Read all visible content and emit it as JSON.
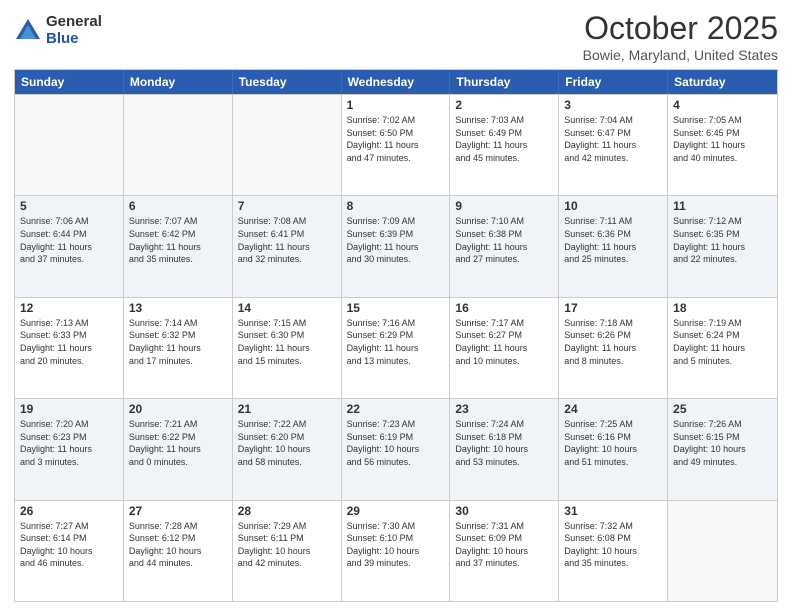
{
  "logo": {
    "general": "General",
    "blue": "Blue"
  },
  "title": "October 2025",
  "location": "Bowie, Maryland, United States",
  "header_days": [
    "Sunday",
    "Monday",
    "Tuesday",
    "Wednesday",
    "Thursday",
    "Friday",
    "Saturday"
  ],
  "rows": [
    {
      "alt": false,
      "cells": [
        {
          "day": "",
          "lines": []
        },
        {
          "day": "",
          "lines": []
        },
        {
          "day": "",
          "lines": []
        },
        {
          "day": "1",
          "lines": [
            "Sunrise: 7:02 AM",
            "Sunset: 6:50 PM",
            "Daylight: 11 hours",
            "and 47 minutes."
          ]
        },
        {
          "day": "2",
          "lines": [
            "Sunrise: 7:03 AM",
            "Sunset: 6:49 PM",
            "Daylight: 11 hours",
            "and 45 minutes."
          ]
        },
        {
          "day": "3",
          "lines": [
            "Sunrise: 7:04 AM",
            "Sunset: 6:47 PM",
            "Daylight: 11 hours",
            "and 42 minutes."
          ]
        },
        {
          "day": "4",
          "lines": [
            "Sunrise: 7:05 AM",
            "Sunset: 6:45 PM",
            "Daylight: 11 hours",
            "and 40 minutes."
          ]
        }
      ]
    },
    {
      "alt": true,
      "cells": [
        {
          "day": "5",
          "lines": [
            "Sunrise: 7:06 AM",
            "Sunset: 6:44 PM",
            "Daylight: 11 hours",
            "and 37 minutes."
          ]
        },
        {
          "day": "6",
          "lines": [
            "Sunrise: 7:07 AM",
            "Sunset: 6:42 PM",
            "Daylight: 11 hours",
            "and 35 minutes."
          ]
        },
        {
          "day": "7",
          "lines": [
            "Sunrise: 7:08 AM",
            "Sunset: 6:41 PM",
            "Daylight: 11 hours",
            "and 32 minutes."
          ]
        },
        {
          "day": "8",
          "lines": [
            "Sunrise: 7:09 AM",
            "Sunset: 6:39 PM",
            "Daylight: 11 hours",
            "and 30 minutes."
          ]
        },
        {
          "day": "9",
          "lines": [
            "Sunrise: 7:10 AM",
            "Sunset: 6:38 PM",
            "Daylight: 11 hours",
            "and 27 minutes."
          ]
        },
        {
          "day": "10",
          "lines": [
            "Sunrise: 7:11 AM",
            "Sunset: 6:36 PM",
            "Daylight: 11 hours",
            "and 25 minutes."
          ]
        },
        {
          "day": "11",
          "lines": [
            "Sunrise: 7:12 AM",
            "Sunset: 6:35 PM",
            "Daylight: 11 hours",
            "and 22 minutes."
          ]
        }
      ]
    },
    {
      "alt": false,
      "cells": [
        {
          "day": "12",
          "lines": [
            "Sunrise: 7:13 AM",
            "Sunset: 6:33 PM",
            "Daylight: 11 hours",
            "and 20 minutes."
          ]
        },
        {
          "day": "13",
          "lines": [
            "Sunrise: 7:14 AM",
            "Sunset: 6:32 PM",
            "Daylight: 11 hours",
            "and 17 minutes."
          ]
        },
        {
          "day": "14",
          "lines": [
            "Sunrise: 7:15 AM",
            "Sunset: 6:30 PM",
            "Daylight: 11 hours",
            "and 15 minutes."
          ]
        },
        {
          "day": "15",
          "lines": [
            "Sunrise: 7:16 AM",
            "Sunset: 6:29 PM",
            "Daylight: 11 hours",
            "and 13 minutes."
          ]
        },
        {
          "day": "16",
          "lines": [
            "Sunrise: 7:17 AM",
            "Sunset: 6:27 PM",
            "Daylight: 11 hours",
            "and 10 minutes."
          ]
        },
        {
          "day": "17",
          "lines": [
            "Sunrise: 7:18 AM",
            "Sunset: 6:26 PM",
            "Daylight: 11 hours",
            "and 8 minutes."
          ]
        },
        {
          "day": "18",
          "lines": [
            "Sunrise: 7:19 AM",
            "Sunset: 6:24 PM",
            "Daylight: 11 hours",
            "and 5 minutes."
          ]
        }
      ]
    },
    {
      "alt": true,
      "cells": [
        {
          "day": "19",
          "lines": [
            "Sunrise: 7:20 AM",
            "Sunset: 6:23 PM",
            "Daylight: 11 hours",
            "and 3 minutes."
          ]
        },
        {
          "day": "20",
          "lines": [
            "Sunrise: 7:21 AM",
            "Sunset: 6:22 PM",
            "Daylight: 11 hours",
            "and 0 minutes."
          ]
        },
        {
          "day": "21",
          "lines": [
            "Sunrise: 7:22 AM",
            "Sunset: 6:20 PM",
            "Daylight: 10 hours",
            "and 58 minutes."
          ]
        },
        {
          "day": "22",
          "lines": [
            "Sunrise: 7:23 AM",
            "Sunset: 6:19 PM",
            "Daylight: 10 hours",
            "and 56 minutes."
          ]
        },
        {
          "day": "23",
          "lines": [
            "Sunrise: 7:24 AM",
            "Sunset: 6:18 PM",
            "Daylight: 10 hours",
            "and 53 minutes."
          ]
        },
        {
          "day": "24",
          "lines": [
            "Sunrise: 7:25 AM",
            "Sunset: 6:16 PM",
            "Daylight: 10 hours",
            "and 51 minutes."
          ]
        },
        {
          "day": "25",
          "lines": [
            "Sunrise: 7:26 AM",
            "Sunset: 6:15 PM",
            "Daylight: 10 hours",
            "and 49 minutes."
          ]
        }
      ]
    },
    {
      "alt": false,
      "cells": [
        {
          "day": "26",
          "lines": [
            "Sunrise: 7:27 AM",
            "Sunset: 6:14 PM",
            "Daylight: 10 hours",
            "and 46 minutes."
          ]
        },
        {
          "day": "27",
          "lines": [
            "Sunrise: 7:28 AM",
            "Sunset: 6:12 PM",
            "Daylight: 10 hours",
            "and 44 minutes."
          ]
        },
        {
          "day": "28",
          "lines": [
            "Sunrise: 7:29 AM",
            "Sunset: 6:11 PM",
            "Daylight: 10 hours",
            "and 42 minutes."
          ]
        },
        {
          "day": "29",
          "lines": [
            "Sunrise: 7:30 AM",
            "Sunset: 6:10 PM",
            "Daylight: 10 hours",
            "and 39 minutes."
          ]
        },
        {
          "day": "30",
          "lines": [
            "Sunrise: 7:31 AM",
            "Sunset: 6:09 PM",
            "Daylight: 10 hours",
            "and 37 minutes."
          ]
        },
        {
          "day": "31",
          "lines": [
            "Sunrise: 7:32 AM",
            "Sunset: 6:08 PM",
            "Daylight: 10 hours",
            "and 35 minutes."
          ]
        },
        {
          "day": "",
          "lines": []
        }
      ]
    }
  ]
}
